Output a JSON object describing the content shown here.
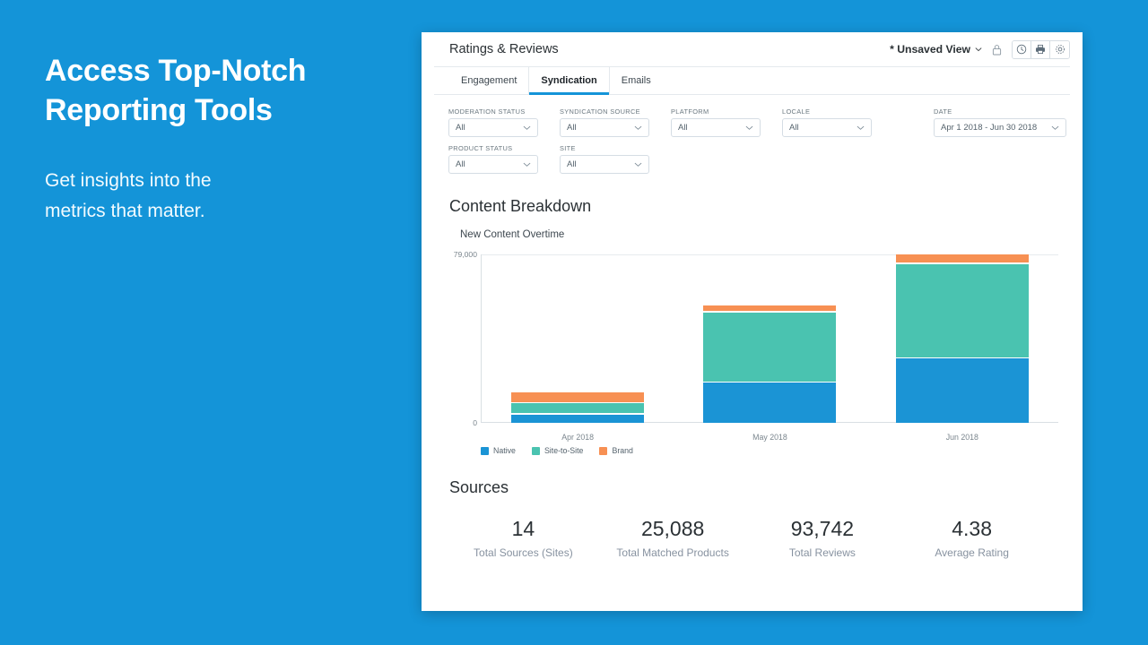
{
  "promo": {
    "headline": "Access Top-Notch\nReporting Tools",
    "subtext": "Get insights into the\nmetrics that matter."
  },
  "app": {
    "title": "Ratings & Reviews",
    "view_name": "* Unsaved View",
    "header_icons": [
      {
        "name": "lock-icon"
      },
      {
        "name": "schedule-clock-icon"
      },
      {
        "name": "print-icon"
      },
      {
        "name": "settings-gear-icon"
      }
    ],
    "tabs": [
      {
        "label": "Engagement",
        "active": false
      },
      {
        "label": "Syndication",
        "active": true
      },
      {
        "label": "Emails",
        "active": false
      }
    ],
    "filters": [
      {
        "label": "MODERATION STATUS",
        "value": "All",
        "wide": false
      },
      {
        "label": "SYNDICATION SOURCE",
        "value": "All",
        "wide": false
      },
      {
        "label": "PLATFORM",
        "value": "All",
        "wide": false
      },
      {
        "label": "LOCALE",
        "value": "All",
        "wide": false
      },
      {
        "label": "DATE",
        "value": "Apr 1 2018 - Jun 30 2018",
        "wide": true
      },
      {
        "label": "PRODUCT STATUS",
        "value": "All",
        "wide": false
      },
      {
        "label": "SITE",
        "value": "All",
        "wide": false
      }
    ],
    "content_section_title": "Content Breakdown",
    "sources_section_title": "Sources",
    "metrics": [
      {
        "value": "14",
        "label": "Total Sources (Sites)"
      },
      {
        "value": "25,088",
        "label": "Total Matched Products"
      },
      {
        "value": "93,742",
        "label": "Total Reviews"
      },
      {
        "value": "4.38",
        "label": "Average Rating"
      }
    ]
  },
  "colors": {
    "brand_blue": "#1494d8",
    "native": "#1b94d5",
    "site_to_site": "#4ac3b0",
    "brand_orange": "#f79053"
  },
  "chart_data": {
    "type": "bar",
    "stacked": true,
    "title": "New Content Overtime",
    "xlabel": "",
    "ylabel": "",
    "categories": [
      "Apr 2018",
      "May 2018",
      "Jun 2018"
    ],
    "series": [
      {
        "name": "Native",
        "color": "#1b94d5",
        "values": [
          3900,
          18900,
          30500
        ]
      },
      {
        "name": "Site-to-Site",
        "color": "#4ac3b0",
        "values": [
          4700,
          32200,
          44200
        ]
      },
      {
        "name": "Brand",
        "color": "#f79053",
        "values": [
          4300,
          2600,
          3900
        ]
      }
    ],
    "ylim": [
      0,
      79000
    ],
    "ytick_labels": [
      "0",
      "79,000"
    ],
    "grid": true,
    "legend_position": "bottom-left"
  }
}
